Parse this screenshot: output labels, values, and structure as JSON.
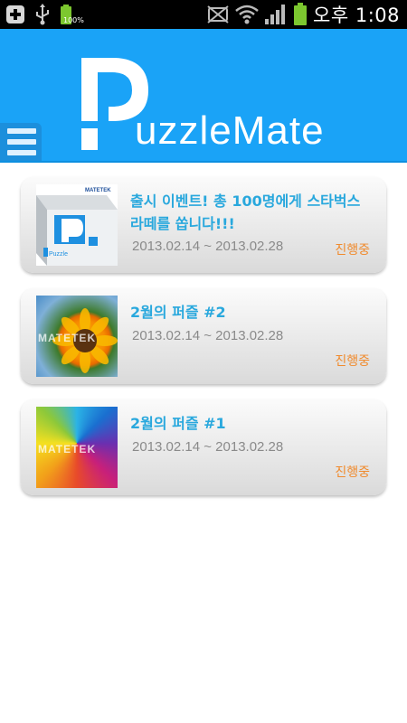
{
  "status_bar": {
    "time": "오후 1:08",
    "battery_label": "100%",
    "icons": [
      "add-icon",
      "usb-icon",
      "battery-small-icon",
      "mute-icon",
      "wifi-icon",
      "signal-icon",
      "battery-icon"
    ]
  },
  "header": {
    "logo_rest": "uzzleMate",
    "logo_icon": "puzzlemate-logo-icon",
    "menu_icon": "hamburger-menu-icon",
    "background": "#1aa3f7"
  },
  "events": [
    {
      "title": "출시 이벤트! 총 100명에게 스타벅스 라떼를 쏩니다!!!",
      "dates": "2013.02.14 ~ 2013.02.28",
      "status": "진행중",
      "thumb_brand": "MATETEK",
      "thumb_caption": "Puzzle"
    },
    {
      "title": "2월의 퍼즐 #2",
      "dates": "2013.02.14 ~ 2013.02.28",
      "status": "진행중",
      "thumb_watermark": "MATETEK"
    },
    {
      "title": "2월의 퍼즐 #1",
      "dates": "2013.02.14 ~ 2013.02.28",
      "status": "진행중",
      "thumb_watermark": "MATETEK"
    }
  ],
  "colors": {
    "title": "#29a8dd",
    "date": "#8a8a8a",
    "status": "#f08a2c"
  }
}
